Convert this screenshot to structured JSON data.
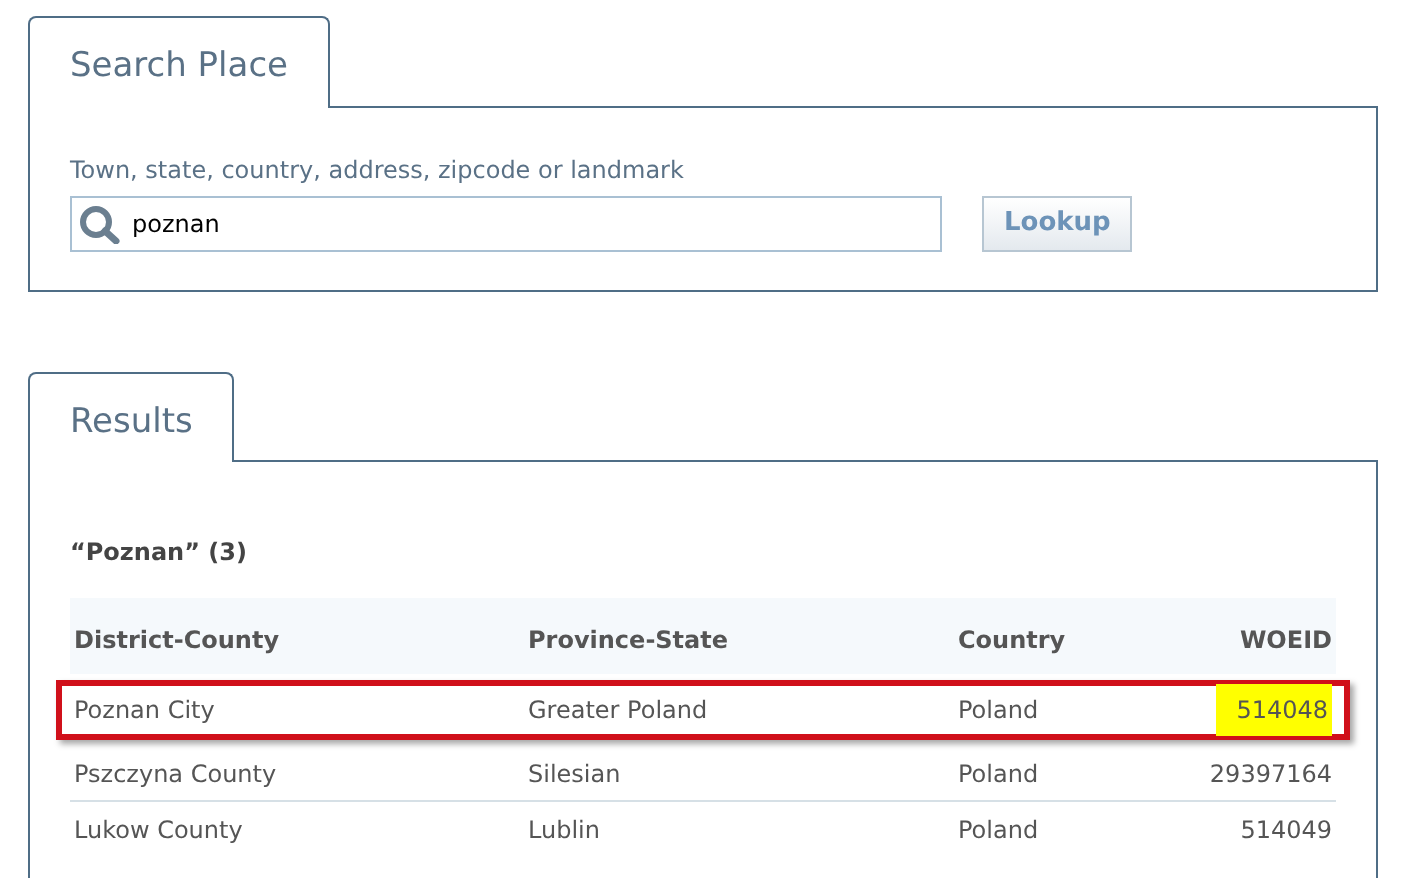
{
  "search_section": {
    "tab": "Search Place",
    "label": "Town, state, country, address, zipcode or landmark",
    "query": "poznan",
    "button": "Lookup"
  },
  "results_section": {
    "tab": "Results",
    "summary": "“Poznan” (3)",
    "table": {
      "columns": [
        "District-County",
        "Province-State",
        "Country",
        "WOEID"
      ],
      "rows": [
        {
          "cells": [
            "Poznan City",
            "Greater Poland",
            "Poland",
            "514048"
          ],
          "selected": true
        },
        {
          "cells": [
            "Pszczyna County",
            "Silesian",
            "Poland",
            "29397164"
          ],
          "selected": false
        },
        {
          "cells": [
            "Lukow County",
            "Lublin",
            "Poland",
            "514049"
          ],
          "selected": false
        }
      ]
    }
  }
}
